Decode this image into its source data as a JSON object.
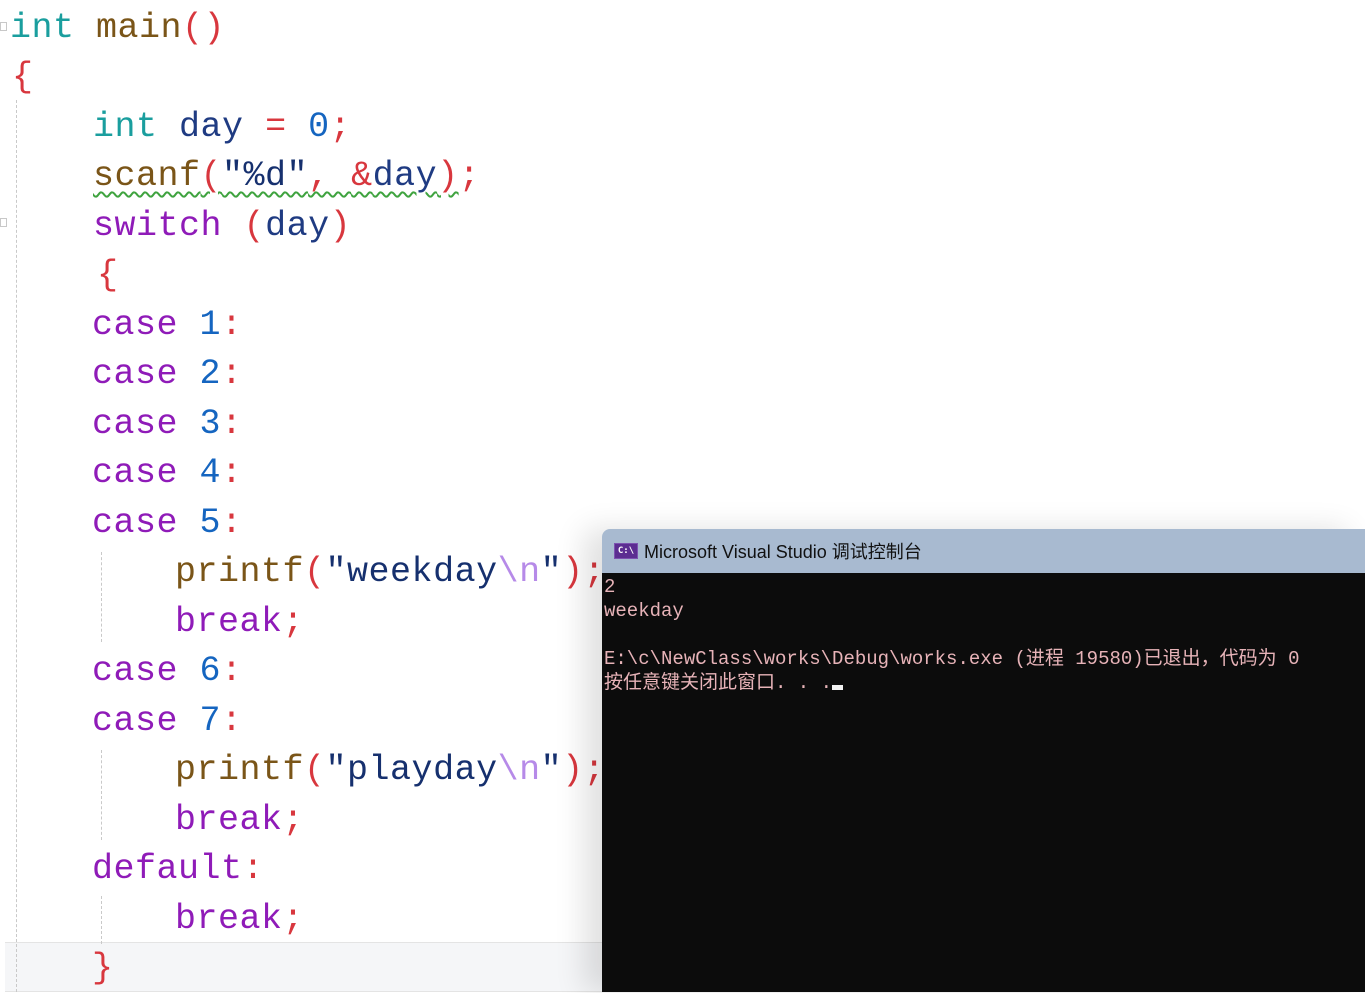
{
  "editor": {
    "lines": [
      {
        "tokens": [
          {
            "t": "int",
            "c": "kw-type"
          },
          {
            "t": " "
          },
          {
            "t": "main",
            "c": "fn"
          },
          {
            "t": "()",
            "c": "punc"
          }
        ]
      },
      {
        "tokens": [
          {
            "t": "{",
            "c": "brace"
          }
        ]
      },
      {
        "tokens": [
          {
            "t": "int",
            "c": "kw-type"
          },
          {
            "t": " "
          },
          {
            "t": "day",
            "c": "var"
          },
          {
            "t": " "
          },
          {
            "t": "=",
            "c": "punc"
          },
          {
            "t": " "
          },
          {
            "t": "0",
            "c": "num"
          },
          {
            "t": ";",
            "c": "punc"
          }
        ]
      },
      {
        "tokens": [
          {
            "t": "scanf",
            "c": "fn"
          },
          {
            "t": "(",
            "c": "punc"
          },
          {
            "t": "\"%d\"",
            "c": "str"
          },
          {
            "t": ", ",
            "c": "punc"
          },
          {
            "t": "&",
            "c": "punc"
          },
          {
            "t": "day",
            "c": "var"
          },
          {
            "t": ")",
            "c": "punc"
          },
          {
            "t": ";",
            "c": "punc"
          }
        ],
        "squiggle": true
      },
      {
        "tokens": [
          {
            "t": "switch",
            "c": "kw-ctrl"
          },
          {
            "t": " "
          },
          {
            "t": "(",
            "c": "punc"
          },
          {
            "t": "day",
            "c": "var"
          },
          {
            "t": ")",
            "c": "punc"
          }
        ]
      },
      {
        "tokens": [
          {
            "t": "{",
            "c": "brace"
          }
        ]
      },
      {
        "tokens": [
          {
            "t": "case",
            "c": "kw-ctrl"
          },
          {
            "t": " "
          },
          {
            "t": "1",
            "c": "num"
          },
          {
            "t": ":",
            "c": "punc"
          }
        ]
      },
      {
        "tokens": [
          {
            "t": "case",
            "c": "kw-ctrl"
          },
          {
            "t": " "
          },
          {
            "t": "2",
            "c": "num"
          },
          {
            "t": ":",
            "c": "punc"
          }
        ]
      },
      {
        "tokens": [
          {
            "t": "case",
            "c": "kw-ctrl"
          },
          {
            "t": " "
          },
          {
            "t": "3",
            "c": "num"
          },
          {
            "t": ":",
            "c": "punc"
          }
        ]
      },
      {
        "tokens": [
          {
            "t": "case",
            "c": "kw-ctrl"
          },
          {
            "t": " "
          },
          {
            "t": "4",
            "c": "num"
          },
          {
            "t": ":",
            "c": "punc"
          }
        ]
      },
      {
        "tokens": [
          {
            "t": "case",
            "c": "kw-ctrl"
          },
          {
            "t": " "
          },
          {
            "t": "5",
            "c": "num"
          },
          {
            "t": ":",
            "c": "punc"
          }
        ]
      },
      {
        "tokens": [
          {
            "t": "printf",
            "c": "fn"
          },
          {
            "t": "(",
            "c": "punc"
          },
          {
            "t": "\"weekday",
            "c": "str"
          },
          {
            "t": "\\n",
            "c": "esc"
          },
          {
            "t": "\"",
            "c": "str"
          },
          {
            "t": ")",
            "c": "punc"
          },
          {
            "t": ";",
            "c": "punc"
          }
        ]
      },
      {
        "tokens": [
          {
            "t": "break",
            "c": "kw-ctrl"
          },
          {
            "t": ";",
            "c": "punc"
          }
        ]
      },
      {
        "tokens": [
          {
            "t": "case",
            "c": "kw-ctrl"
          },
          {
            "t": " "
          },
          {
            "t": "6",
            "c": "num"
          },
          {
            "t": ":",
            "c": "punc"
          }
        ]
      },
      {
        "tokens": [
          {
            "t": "case",
            "c": "kw-ctrl"
          },
          {
            "t": " "
          },
          {
            "t": "7",
            "c": "num"
          },
          {
            "t": ":",
            "c": "punc"
          }
        ]
      },
      {
        "tokens": [
          {
            "t": "printf",
            "c": "fn"
          },
          {
            "t": "(",
            "c": "punc"
          },
          {
            "t": "\"playday",
            "c": "str"
          },
          {
            "t": "\\n",
            "c": "esc"
          },
          {
            "t": "\"",
            "c": "str"
          },
          {
            "t": ")",
            "c": "punc"
          },
          {
            "t": ";",
            "c": "punc"
          }
        ]
      },
      {
        "tokens": [
          {
            "t": "break",
            "c": "kw-ctrl"
          },
          {
            "t": ";",
            "c": "punc"
          }
        ]
      },
      {
        "tokens": [
          {
            "t": "default",
            "c": "kw-ctrl"
          },
          {
            "t": ":",
            "c": "punc"
          }
        ]
      },
      {
        "tokens": [
          {
            "t": "break",
            "c": "kw-ctrl"
          },
          {
            "t": ";",
            "c": "punc"
          }
        ]
      },
      {
        "tokens": [
          {
            "t": "}",
            "c": "brace"
          }
        ]
      }
    ]
  },
  "console": {
    "icon": "console-app-icon",
    "icon_text": "C:\\",
    "title": "Microsoft Visual Studio 调试控制台",
    "output_lines": [
      "2",
      "weekday",
      "",
      "E:\\c\\NewClass\\works\\Debug\\works.exe (进程 19580)已退出，代码为 0",
      "按任意键关闭此窗口. . ."
    ]
  }
}
